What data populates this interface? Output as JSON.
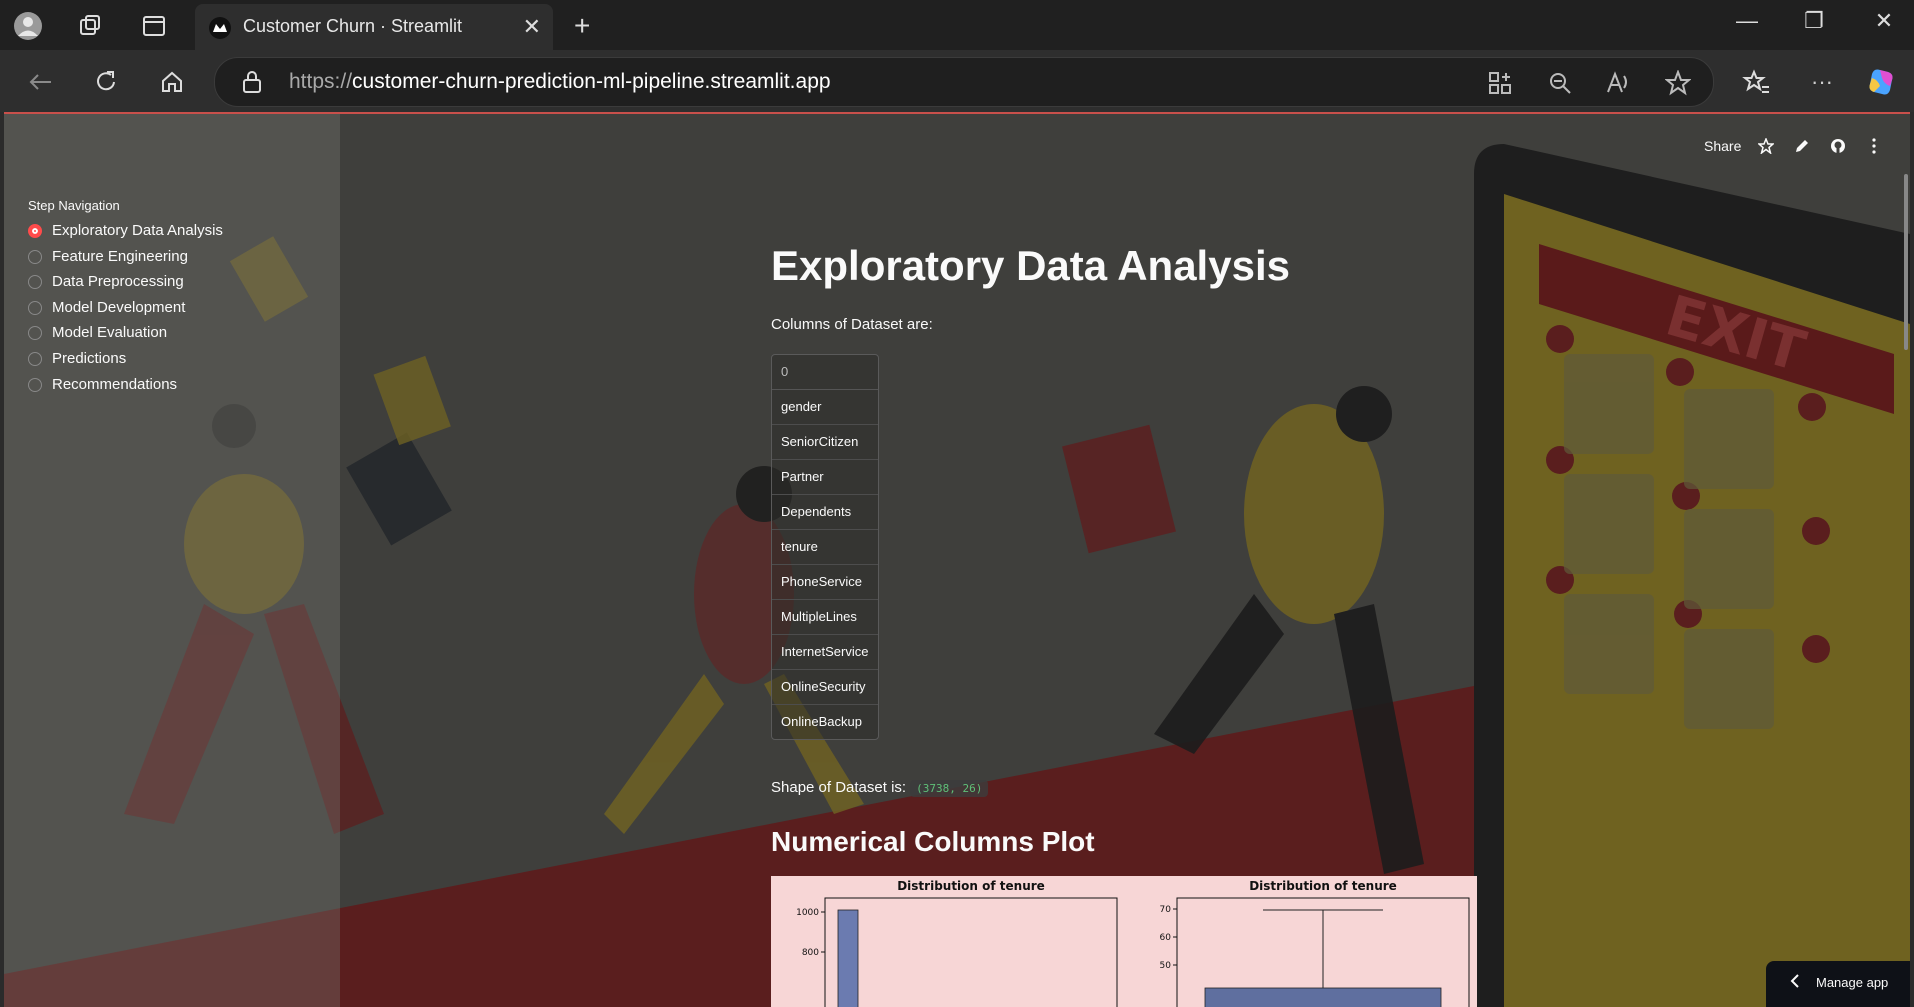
{
  "browser": {
    "tab_title": "Customer Churn · Streamlit",
    "url_proto": "https://",
    "url_host": "customer-churn-prediction-ml-pipeline.streamlit.app"
  },
  "sidebar": {
    "title": "Step Navigation",
    "items": [
      {
        "label": "Exploratory Data Analysis",
        "selected": true
      },
      {
        "label": "Feature Engineering",
        "selected": false
      },
      {
        "label": "Data Preprocessing",
        "selected": false
      },
      {
        "label": "Model Development",
        "selected": false
      },
      {
        "label": "Model Evaluation",
        "selected": false
      },
      {
        "label": "Predictions",
        "selected": false
      },
      {
        "label": "Recommendations",
        "selected": false
      }
    ]
  },
  "header": {
    "share_label": "Share"
  },
  "main": {
    "title": "Exploratory Data Analysis",
    "columns_label": "Columns of Dataset are:",
    "table_header": "0",
    "columns": [
      "gender",
      "SeniorCitizen",
      "Partner",
      "Dependents",
      "tenure",
      "PhoneService",
      "MultipleLines",
      "InternetService",
      "OnlineSecurity",
      "OnlineBackup"
    ],
    "shape_label": "Shape of Dataset is:",
    "shape_value": "(3738, 26)",
    "plot_heading": "Numerical Columns Plot"
  },
  "chart_data": [
    {
      "type": "bar",
      "title": "Distribution of tenure",
      "yticks": [
        800,
        1000
      ]
    },
    {
      "type": "box",
      "title": "Distribution of tenure",
      "yticks": [
        50,
        60,
        70
      ]
    }
  ],
  "footer": {
    "manage_label": "Manage app"
  },
  "colors": {
    "accent": "#ff4b4b",
    "plot_bg": "#f7d6d6"
  }
}
